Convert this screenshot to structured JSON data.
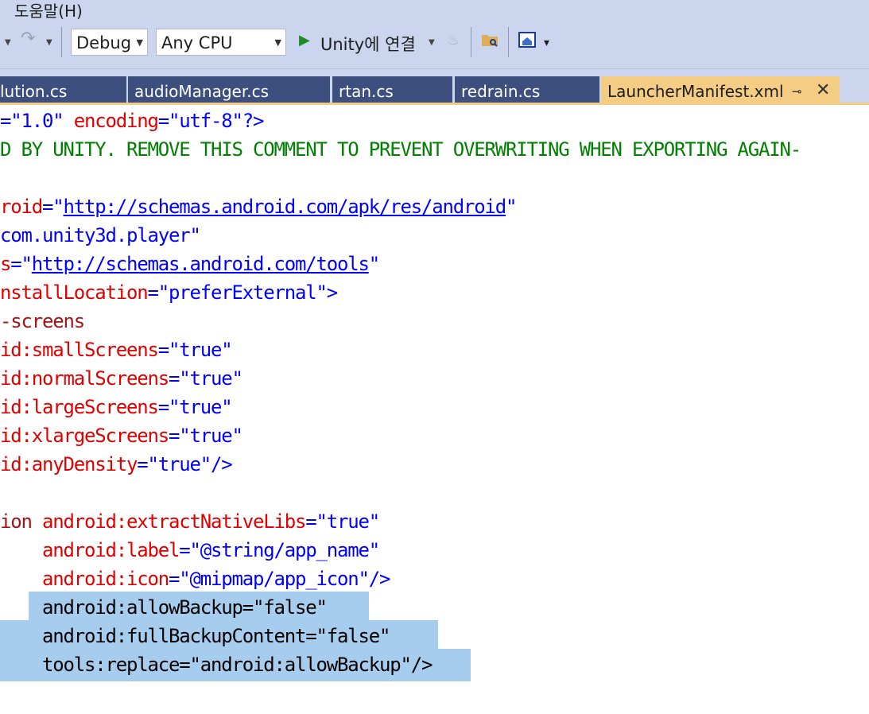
{
  "menu": {
    "help": "도움말(H)"
  },
  "toolbar": {
    "config": "Debug",
    "platform": "Any CPU",
    "run_label": "Unity에 연결"
  },
  "tabs": [
    {
      "label": "lution.cs"
    },
    {
      "label": "audioManager.cs"
    },
    {
      "label": "rtan.cs"
    },
    {
      "label": "redrain.cs"
    },
    {
      "label": "LauncherManifest.xml",
      "active": true
    }
  ],
  "editor": {
    "lines": [
      [
        {
          "t": "=\"",
          "c": "blue"
        },
        {
          "t": "1.0",
          "c": "blue"
        },
        {
          "t": "\" ",
          "c": "blue"
        },
        {
          "t": "encoding",
          "c": "red"
        },
        {
          "t": "=\"",
          "c": "blue"
        },
        {
          "t": "utf-8",
          "c": "blue"
        },
        {
          "t": "\"?>",
          "c": "blue"
        }
      ],
      [
        {
          "t": "D BY UNITY. REMOVE THIS COMMENT TO PREVENT OVERWRITING WHEN EXPORTING AGAIN-",
          "c": "green"
        }
      ],
      [],
      [
        {
          "t": "roid",
          "c": "red"
        },
        {
          "t": "=\"",
          "c": "blue"
        },
        {
          "t": "http://schemas.android.com/apk/res/android",
          "c": "link"
        },
        {
          "t": "\"",
          "c": "blue"
        }
      ],
      [
        {
          "t": "com.unity3d.player",
          "c": "blue"
        },
        {
          "t": "\"",
          "c": "blue"
        }
      ],
      [
        {
          "t": "s",
          "c": "red"
        },
        {
          "t": "=\"",
          "c": "blue"
        },
        {
          "t": "http://schemas.android.com/tools",
          "c": "link"
        },
        {
          "t": "\"",
          "c": "blue"
        }
      ],
      [
        {
          "t": "nstallLocation",
          "c": "red"
        },
        {
          "t": "=\"",
          "c": "blue"
        },
        {
          "t": "preferExternal",
          "c": "blue"
        },
        {
          "t": "\">",
          "c": "blue"
        }
      ],
      [
        {
          "t": "-screens",
          "c": "maroon"
        }
      ],
      [
        {
          "t": "id:smallScreens",
          "c": "red"
        },
        {
          "t": "=\"",
          "c": "blue"
        },
        {
          "t": "true",
          "c": "blue"
        },
        {
          "t": "\"",
          "c": "blue"
        }
      ],
      [
        {
          "t": "id:normalScreens",
          "c": "red"
        },
        {
          "t": "=\"",
          "c": "blue"
        },
        {
          "t": "true",
          "c": "blue"
        },
        {
          "t": "\"",
          "c": "blue"
        }
      ],
      [
        {
          "t": "id:largeScreens",
          "c": "red"
        },
        {
          "t": "=\"",
          "c": "blue"
        },
        {
          "t": "true",
          "c": "blue"
        },
        {
          "t": "\"",
          "c": "blue"
        }
      ],
      [
        {
          "t": "id:xlargeScreens",
          "c": "red"
        },
        {
          "t": "=\"",
          "c": "blue"
        },
        {
          "t": "true",
          "c": "blue"
        },
        {
          "t": "\"",
          "c": "blue"
        }
      ],
      [
        {
          "t": "id:anyDensity",
          "c": "red"
        },
        {
          "t": "=\"",
          "c": "blue"
        },
        {
          "t": "true",
          "c": "blue"
        },
        {
          "t": "\"/>",
          "c": "blue"
        }
      ],
      [],
      [
        {
          "t": "ion ",
          "c": "maroon"
        },
        {
          "t": "android:extractNativeLibs",
          "c": "red"
        },
        {
          "t": "=\"",
          "c": "blue"
        },
        {
          "t": "true",
          "c": "blue"
        },
        {
          "t": "\"",
          "c": "blue"
        }
      ],
      [
        {
          "t": "    ",
          "c": "black"
        },
        {
          "t": "android:label",
          "c": "red"
        },
        {
          "t": "=\"",
          "c": "blue"
        },
        {
          "t": "@string/app_name",
          "c": "blue"
        },
        {
          "t": "\"",
          "c": "blue"
        }
      ],
      [
        {
          "t": "    ",
          "c": "black"
        },
        {
          "t": "android:icon",
          "c": "red"
        },
        {
          "t": "=\"",
          "c": "blue"
        },
        {
          "t": "@mipmap/app_icon",
          "c": "blue"
        },
        {
          "t": "\"/>",
          "c": "blue"
        }
      ],
      [
        {
          "t": "    android:allowBackup=\"false\"",
          "c": "black"
        }
      ],
      [
        {
          "t": "    android:fullBackupContent=\"false\"",
          "c": "black"
        }
      ],
      [
        {
          "t": "    tools:replace=\"android:allowBackup\"/>",
          "c": "black"
        }
      ]
    ]
  }
}
